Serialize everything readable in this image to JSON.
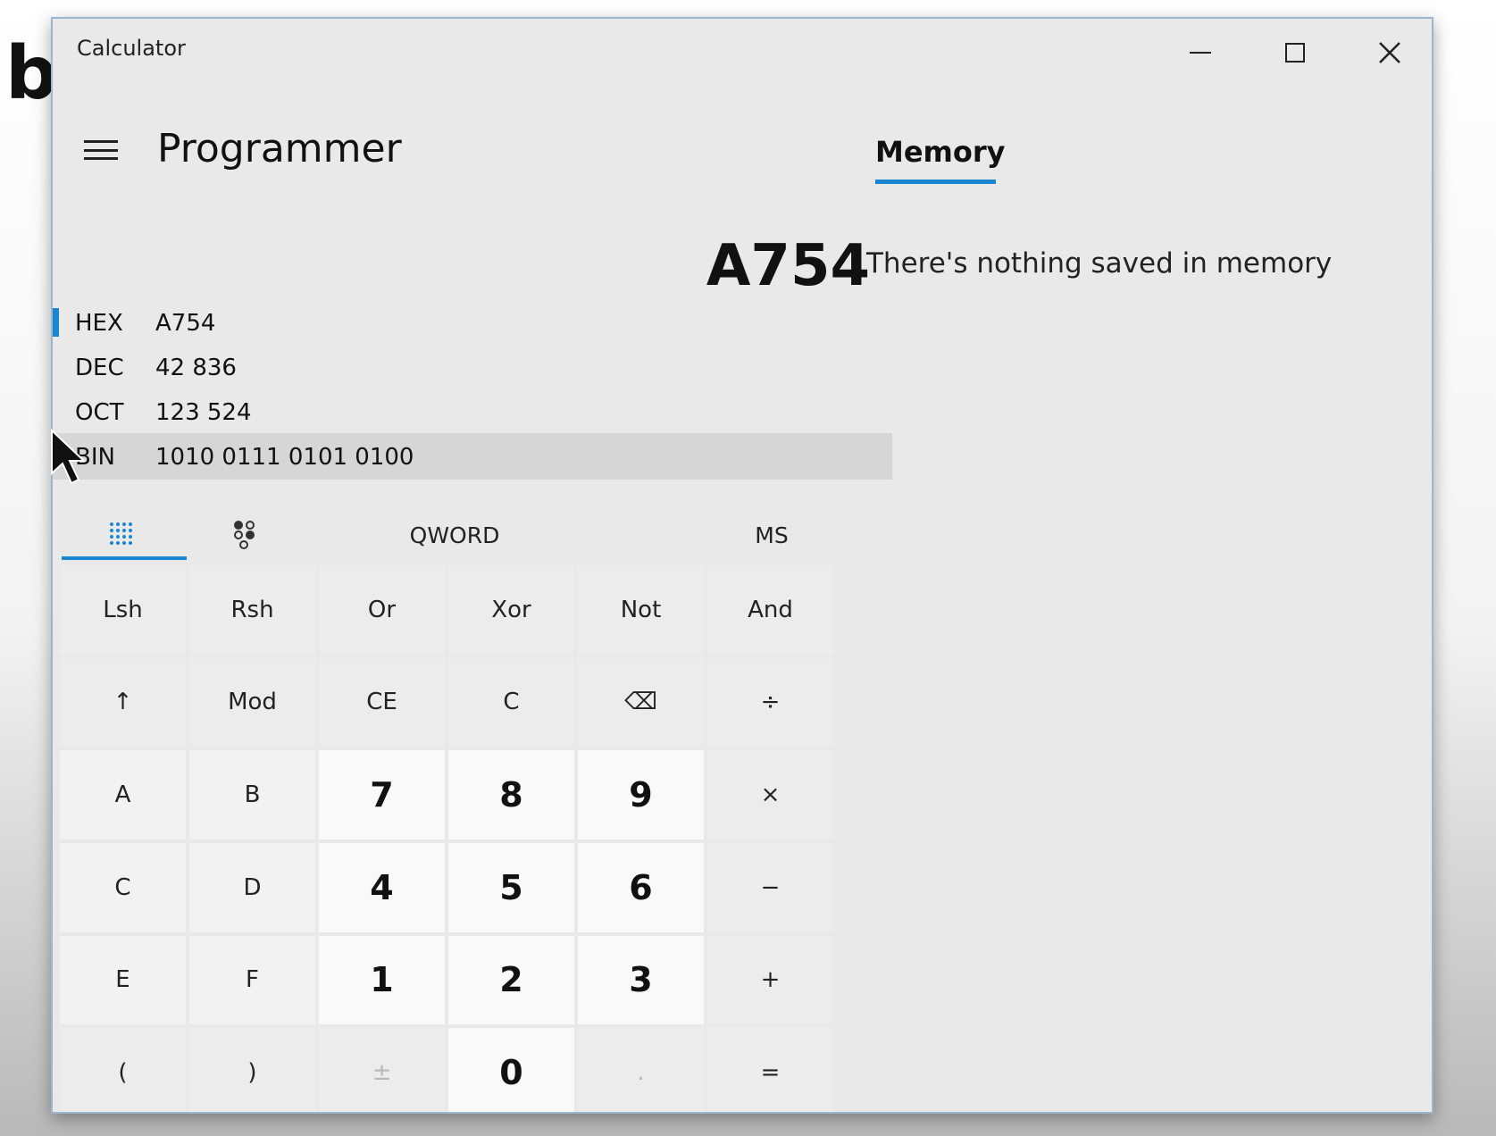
{
  "background_letter": "b",
  "window": {
    "title": "Calculator"
  },
  "header": {
    "mode": "Programmer"
  },
  "display": {
    "value": "A754"
  },
  "radix": [
    {
      "label": "HEX",
      "value": "A754",
      "selected": true
    },
    {
      "label": "DEC",
      "value": "42 836"
    },
    {
      "label": "OCT",
      "value": "123 524"
    },
    {
      "label": "BIN",
      "value": "1010 0111 0101 0100"
    }
  ],
  "toolbar": {
    "keypad_icon": "keypad-icon",
    "bitflip_icon": "bit-toggling-icon",
    "word_size": "QWORD",
    "memory_store": "MS"
  },
  "keys": {
    "lsh": "Lsh",
    "rsh": "Rsh",
    "or": "Or",
    "xor": "Xor",
    "not": "Not",
    "and": "And",
    "shift": "↑",
    "mod": "Mod",
    "ce": "CE",
    "c": "C",
    "backspace": "⌫",
    "divide": "÷",
    "a": "A",
    "b": "B",
    "seven": "7",
    "eight": "8",
    "nine": "9",
    "multiply": "×",
    "hc": "C",
    "d": "D",
    "four": "4",
    "five": "5",
    "six": "6",
    "minus": "−",
    "e": "E",
    "f": "F",
    "one": "1",
    "two": "2",
    "three": "3",
    "plus": "+",
    "lparen": "(",
    "rparen": ")",
    "negate": "±",
    "zero": "0",
    "decimal": ".",
    "equals": "="
  },
  "memory": {
    "tab": "Memory",
    "empty_message": "There's nothing saved in memory"
  },
  "colors": {
    "accent": "#1a86d0",
    "window_bg": "#e9e9e9"
  }
}
